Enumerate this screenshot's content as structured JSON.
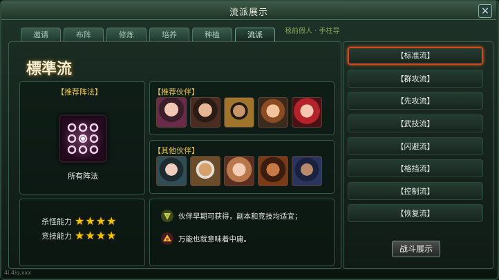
{
  "window": {
    "title": "流派展示",
    "close_icon": "×"
  },
  "tabs": [
    {
      "label": "邀请",
      "active": false
    },
    {
      "label": "布阵",
      "active": false
    },
    {
      "label": "修炼",
      "active": false
    },
    {
      "label": "培养",
      "active": false
    },
    {
      "label": "种植",
      "active": false
    },
    {
      "label": "流派",
      "active": true
    }
  ],
  "background_text": "毯前假人 · 手柱导",
  "school": {
    "heading": "標準流",
    "formation": {
      "label": "【推荐阵法】",
      "caption": "所有阵法",
      "icon": "formation-grid-icon"
    },
    "recommended_partners": {
      "label": "【推荐伙伴】",
      "count": 5
    },
    "other_partners": {
      "label": "【其他伙伴】",
      "count": 5
    },
    "ratings": [
      {
        "label": "杀怪能力",
        "stars": 4,
        "display": "★★★★"
      },
      {
        "label": "竞技能力",
        "stars": 4,
        "display": "★★★★"
      }
    ],
    "descriptions": [
      {
        "icon": "pros-badge-icon",
        "text": "伙伴早期可获得，副本和竞技均适宜；"
      },
      {
        "icon": "cons-badge-icon",
        "text": "万能也就意味着中庸。"
      }
    ]
  },
  "sidebar": {
    "items": [
      {
        "label": "【标准流】",
        "active": true
      },
      {
        "label": "【群攻流】",
        "active": false
      },
      {
        "label": "【先攻流】",
        "active": false
      },
      {
        "label": "【武技流】",
        "active": false
      },
      {
        "label": "【闪避流】",
        "active": false
      },
      {
        "label": "【格挡流】",
        "active": false
      },
      {
        "label": "【控制流】",
        "active": false
      },
      {
        "label": "【恢复流】",
        "active": false
      }
    ],
    "battle_button": "战斗展示"
  },
  "bottom_text": "4l.4iq.xxx",
  "colors": {
    "accent_gold": "#e9c84f",
    "active_border": "#d14a1f",
    "star": "#f2c200"
  }
}
